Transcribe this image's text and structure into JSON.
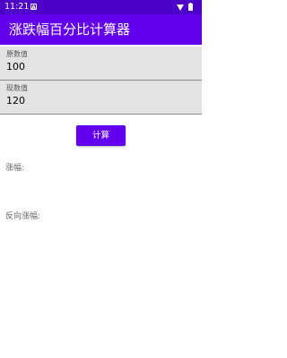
{
  "status_bar": {
    "time": "11:21",
    "notification_glyph": "A",
    "icons": [
      "wifi-icon",
      "battery-icon"
    ],
    "color": "#4d00c8"
  },
  "app_bar": {
    "title": "涨跌幅百分比计算器",
    "color": "#6200ee"
  },
  "form": {
    "original": {
      "label": "原数值",
      "value": "100"
    },
    "current": {
      "label": "现数值",
      "value": "120"
    },
    "calculate_label": "计算"
  },
  "results": {
    "increase_label": "涨幅:",
    "reverse_label": "反向涨幅:"
  }
}
